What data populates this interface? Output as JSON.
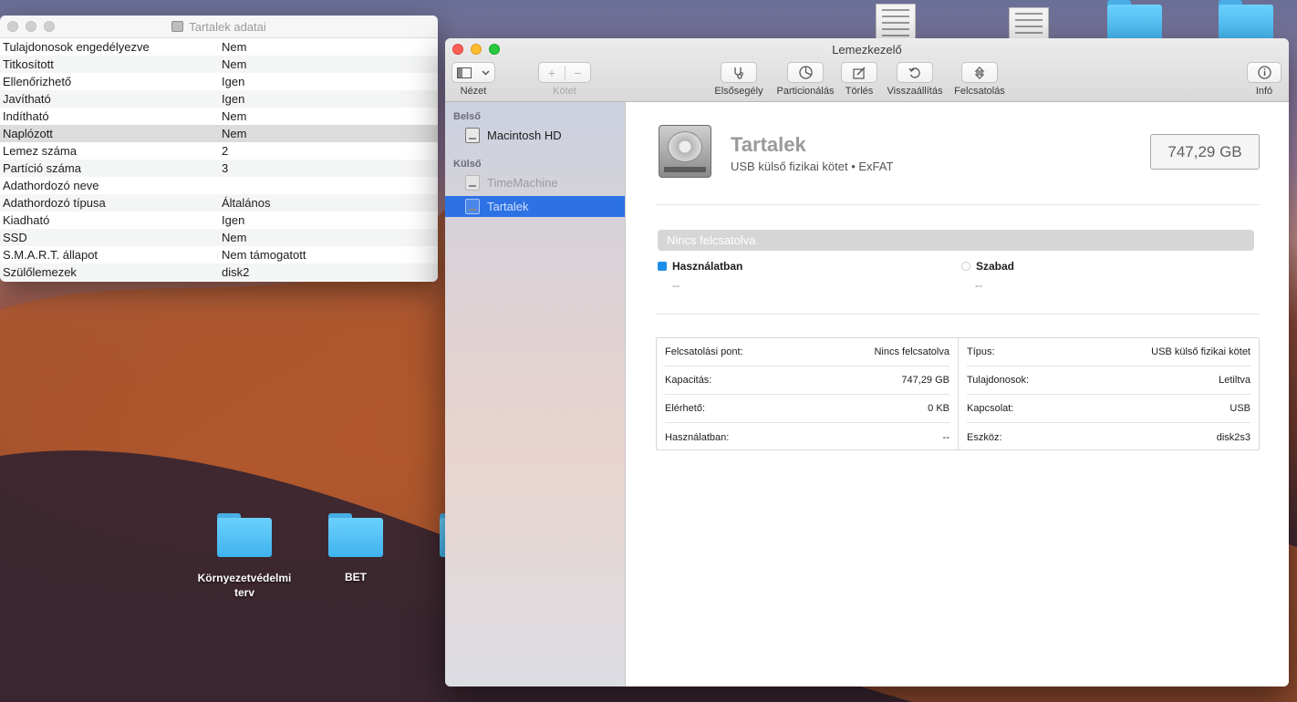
{
  "desktop": {
    "folders": [
      {
        "label": "Környezetvédelmi terv"
      },
      {
        "label": "BET"
      }
    ]
  },
  "info_window": {
    "title": "Tartalek adatai",
    "rows": [
      {
        "key": "Tulajdonosok engedélyezve",
        "value": "Nem"
      },
      {
        "key": "Titkosított",
        "value": "Nem"
      },
      {
        "key": "Ellenőrizhető",
        "value": "Igen"
      },
      {
        "key": "Javítható",
        "value": "Igen"
      },
      {
        "key": "Indítható",
        "value": "Nem"
      },
      {
        "key": "Naplózott",
        "value": "Nem"
      },
      {
        "key": "Lemez száma",
        "value": "2"
      },
      {
        "key": "Partíció száma",
        "value": "3"
      },
      {
        "key": "Adathordozó neve",
        "value": ""
      },
      {
        "key": "Adathordozó típusa",
        "value": "Általános"
      },
      {
        "key": "Kiadható",
        "value": "Igen"
      },
      {
        "key": "SSD",
        "value": "Nem"
      },
      {
        "key": "S.M.A.R.T. állapot",
        "value": "Nem támogatott"
      },
      {
        "key": "Szülőlemezek",
        "value": "disk2"
      }
    ]
  },
  "disk_utility": {
    "title": "Lemezkezelő",
    "toolbar": {
      "view": "Nézet",
      "volume": "Kötet",
      "first_aid": "Elsősegély",
      "partition": "Particionálás",
      "erase": "Törlés",
      "restore": "Visszaállítás",
      "mount": "Felcsatolás",
      "info": "Infó"
    },
    "sidebar": {
      "internal_header": "Belső",
      "internal_items": [
        "Macintosh HD"
      ],
      "external_header": "Külső",
      "external_items": [
        "TimeMachine",
        "Tartalek"
      ]
    },
    "volume": {
      "name": "Tartalek",
      "subtitle": "USB külső fizikai kötet • ExFAT",
      "capacity": "747,29 GB",
      "mount_status": "Nincs felcsatolva",
      "used_label": "Használatban",
      "used_value": "--",
      "free_label": "Szabad",
      "free_value": "--"
    },
    "properties_left": [
      {
        "key": "Felcsatolási pont:",
        "value": "Nincs felcsatolva"
      },
      {
        "key": "Kapacitás:",
        "value": "747,29 GB"
      },
      {
        "key": "Elérhető:",
        "value": "0 KB"
      },
      {
        "key": "Használatban:",
        "value": "--"
      }
    ],
    "properties_right": [
      {
        "key": "Típus:",
        "value": "USB külső fizikai kötet"
      },
      {
        "key": "Tulajdonosok:",
        "value": "Letiltva"
      },
      {
        "key": "Kapcsolat:",
        "value": "USB"
      },
      {
        "key": "Eszköz:",
        "value": "disk2s3"
      }
    ]
  },
  "colors": {
    "accent": "#2d72e4",
    "used_swatch": "#1e8fe9",
    "free_swatch": "#ffffff"
  }
}
